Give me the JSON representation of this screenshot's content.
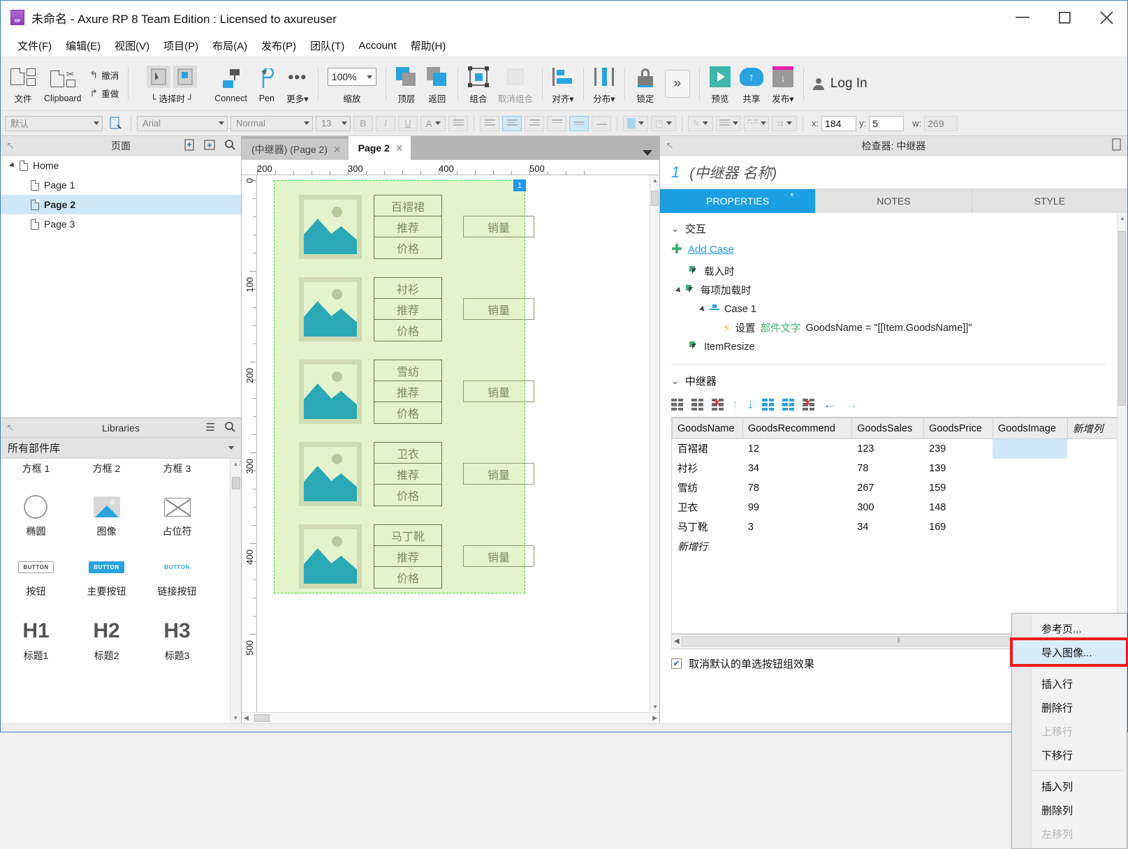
{
  "window": {
    "title": "未命名 - Axure RP 8 Team Edition : Licensed to axureuser",
    "minimize": "—",
    "maximize": "□",
    "close": "✕"
  },
  "menubar": {
    "items": [
      "文件(F)",
      "编辑(E)",
      "视图(V)",
      "项目(P)",
      "布局(A)",
      "发布(P)",
      "团队(T)",
      "Account",
      "帮助(H)"
    ]
  },
  "toolbar": {
    "file_label": "文件",
    "clipboard_label": "Clipboard",
    "undo_label": "撤消",
    "redo_label": "重做",
    "select_label": "└ 选择时 ┘",
    "connect_label": "Connect",
    "pen_label": "Pen",
    "more_label": "更多▾",
    "zoom_value": "100%",
    "zoom_label": "缩放",
    "front_label": "顶层",
    "back_label": "返回",
    "group_label": "组合",
    "ungroup_label": "取消组合",
    "align_label": "对齐▾",
    "distribute_label": "分布▾",
    "lock_label": "锁定",
    "overflow_label": "»",
    "preview_label": "预览",
    "share_label": "共享",
    "publish_label": "发布▾",
    "login_label": "Log In"
  },
  "stylebar": {
    "style_value": "默认",
    "font_value": "Arial",
    "weight_value": "Normal",
    "size_value": "13",
    "bold": "B",
    "italic": "I",
    "underline": "U",
    "color": "A",
    "x_label": "x:",
    "x_value": "184",
    "y_label": "y:",
    "y_value": "5",
    "w_label": "w:",
    "w_value": "269"
  },
  "pages_panel": {
    "title": "页面",
    "items": [
      {
        "label": "Home",
        "level": 0,
        "selected": false,
        "expanded": true
      },
      {
        "label": "Page 1",
        "level": 1,
        "selected": false
      },
      {
        "label": "Page 2",
        "level": 1,
        "selected": true
      },
      {
        "label": "Page 3",
        "level": 1,
        "selected": false
      }
    ]
  },
  "libraries_panel": {
    "title": "Libraries",
    "selector_value": "所有部件库",
    "items": [
      {
        "label": "方框 1",
        "icon": "box1-icon"
      },
      {
        "label": "方框 2",
        "icon": "box2-icon"
      },
      {
        "label": "方框 3",
        "icon": "box3-icon"
      },
      {
        "label": "椭圆",
        "icon": "ellipse-icon"
      },
      {
        "label": "图像",
        "icon": "image-icon"
      },
      {
        "label": "占位符",
        "icon": "placeholder-icon"
      },
      {
        "label": "按钮",
        "icon": "button-icon",
        "chip": "BUTTON"
      },
      {
        "label": "主要按钮",
        "icon": "primary-button-icon",
        "chip": "BUTTON"
      },
      {
        "label": "链接按钮",
        "icon": "link-button-icon",
        "chip": "BUTTON"
      },
      {
        "label": "标题1",
        "icon": "h1-icon",
        "chip": "H1"
      },
      {
        "label": "标题2",
        "icon": "h2-icon",
        "chip": "H2"
      },
      {
        "label": "标题3",
        "icon": "h3-icon",
        "chip": "H3"
      }
    ]
  },
  "canvas": {
    "tabs": [
      {
        "label": "(中继器) (Page 2)",
        "active": false
      },
      {
        "label": "Page 2",
        "active": true
      }
    ],
    "ruler_h_labels": [
      "200",
      "300",
      "400",
      "500"
    ],
    "ruler_v_labels": [
      "0",
      "100",
      "200",
      "300",
      "400",
      "500"
    ],
    "repeater_handle": "1",
    "field_recommend": "推荐",
    "field_price": "价格",
    "sales_label": "销量",
    "items": [
      {
        "name": "百褶裙"
      },
      {
        "name": "衬衫"
      },
      {
        "name": "雪纺"
      },
      {
        "name": "卫衣"
      },
      {
        "name": "马丁靴"
      }
    ]
  },
  "inspector": {
    "title": "检查器: 中继器",
    "widget_number": "1",
    "widget_name": "(中继器 名称)",
    "tabs": [
      {
        "label": "PROPERTIES",
        "active": true,
        "star": "*"
      },
      {
        "label": "NOTES",
        "active": false
      },
      {
        "label": "STYLE",
        "active": false
      }
    ],
    "interactions": {
      "section_title": "交互",
      "add_case": "Add Case",
      "events": [
        {
          "label": "载入时",
          "indent": 0,
          "expandable": false
        },
        {
          "label": "每项加载时",
          "indent": 0,
          "expandable": true
        },
        {
          "label": "Case 1",
          "indent": 1,
          "expandable": true,
          "type": "case"
        },
        {
          "label_prefix": "设置",
          "label_green": "部件文字",
          "label_rest": "GoodsName = \"[[Item.GoodsName]]\"",
          "indent": 2,
          "type": "action"
        },
        {
          "label": "ItemResize",
          "indent": 0,
          "expandable": false
        }
      ]
    },
    "repeater": {
      "section_title": "中继器",
      "toolbar_icons": [
        "add-row-before-icon",
        "add-row-after-icon",
        "delete-row-icon",
        "move-up-icon",
        "move-down-icon",
        "add-col-before-icon",
        "add-col-after-icon",
        "delete-col-icon",
        "move-left-icon",
        "move-right-icon"
      ],
      "columns": [
        "GoodsName",
        "GoodsRecommend",
        "GoodsSales",
        "GoodsPrice",
        "GoodsImage",
        "新增列"
      ],
      "rows": [
        [
          "百褶裙",
          "12",
          "123",
          "239",
          "",
          ""
        ],
        [
          "衬衫",
          "34",
          "78",
          "139",
          "",
          ""
        ],
        [
          "雪纺",
          "78",
          "267",
          "159",
          "",
          ""
        ],
        [
          "卫衣",
          "99",
          "300",
          "148",
          "",
          ""
        ],
        [
          "马丁靴",
          "3",
          "34",
          "169",
          "",
          ""
        ]
      ],
      "new_row_label": "新增行",
      "selected_cell": {
        "row": 0,
        "col": 4
      }
    },
    "checkbox_label": "取消默认的单选按钮组效果",
    "checkbox_checked": true
  },
  "context_menu": {
    "items": [
      {
        "label": "参考页...",
        "disabled": false,
        "highlighted": false
      },
      {
        "label": "导入图像...",
        "disabled": false,
        "highlighted": true
      },
      {
        "separator": true
      },
      {
        "label": "插入行",
        "disabled": false
      },
      {
        "label": "删除行",
        "disabled": false
      },
      {
        "label": "上移行",
        "disabled": true
      },
      {
        "label": "下移行",
        "disabled": false
      },
      {
        "separator": true
      },
      {
        "label": "插入列",
        "disabled": false
      },
      {
        "label": "删除列",
        "disabled": false
      },
      {
        "label": "左移列",
        "disabled": true
      }
    ],
    "highlight_color": "#d8ecf9",
    "annotation_color": "#ef1b1b"
  }
}
